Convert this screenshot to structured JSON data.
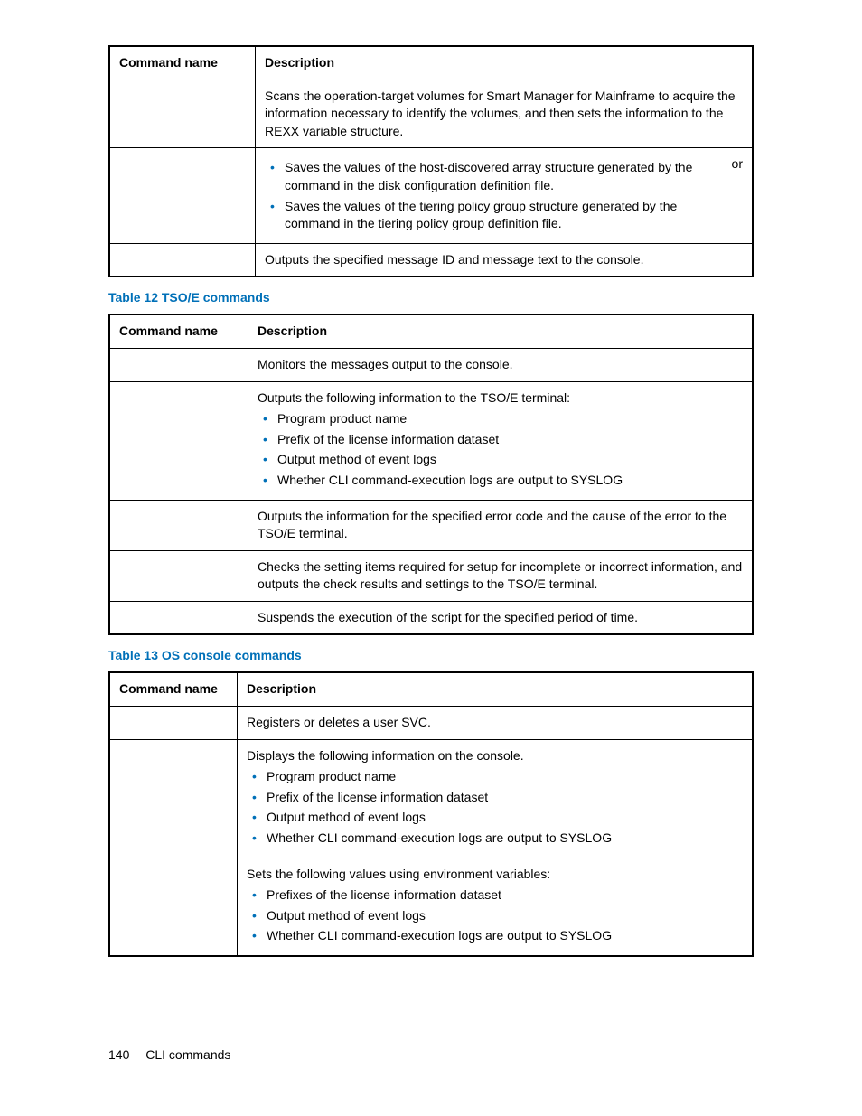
{
  "table1": {
    "headers": {
      "cmd": "Command name",
      "desc": "Description"
    },
    "rows": [
      {
        "desc_text": "Scans the operation-target volumes for Smart Manager for Mainframe to acquire the information necessary to identify the volumes, and then sets the information to the REXX variable structure."
      },
      {
        "or_word": "or",
        "bullets": [
          "Saves the values of the host-discovered array structure generated by the command in the disk configuration definition file.",
          "Saves the values of the tiering policy group structure generated by the command in the tiering policy group definition file."
        ]
      },
      {
        "desc_text": "Outputs the specified message ID and message text to the console."
      }
    ]
  },
  "caption1": "Table 12 TSO/E commands",
  "table2": {
    "headers": {
      "cmd": "Command name",
      "desc": "Description"
    },
    "rows": [
      {
        "desc_text": "Monitors the messages output to the console."
      },
      {
        "lead": "Outputs the following information to the TSO/E terminal:",
        "bullets": [
          "Program product name",
          "Prefix of the license information dataset",
          "Output method of event logs",
          "Whether CLI command-execution logs are output to SYSLOG"
        ]
      },
      {
        "desc_text": "Outputs the information for the specified error code and the cause of the error to the TSO/E terminal."
      },
      {
        "desc_text": "Checks the setting items required for setup for incomplete or incorrect information, and outputs the check results and settings to the TSO/E terminal."
      },
      {
        "desc_text": "Suspends the execution of the script for the specified period of time."
      }
    ]
  },
  "caption2": "Table 13 OS console commands",
  "table3": {
    "headers": {
      "cmd": "Command name",
      "desc": "Description"
    },
    "rows": [
      {
        "desc_text": "Registers or deletes a user SVC."
      },
      {
        "lead": "Displays the following information on the console.",
        "bullets": [
          "Program product name",
          "Prefix of the license information dataset",
          "Output method of event logs",
          "Whether CLI command-execution logs are output to SYSLOG"
        ]
      },
      {
        "lead": "Sets the following values using environment variables:",
        "bullets": [
          "Prefixes of the license information dataset",
          "Output method of event logs",
          "Whether CLI command-execution logs are output to SYSLOG"
        ]
      }
    ]
  },
  "footer": {
    "page": "140",
    "section": "CLI commands"
  }
}
